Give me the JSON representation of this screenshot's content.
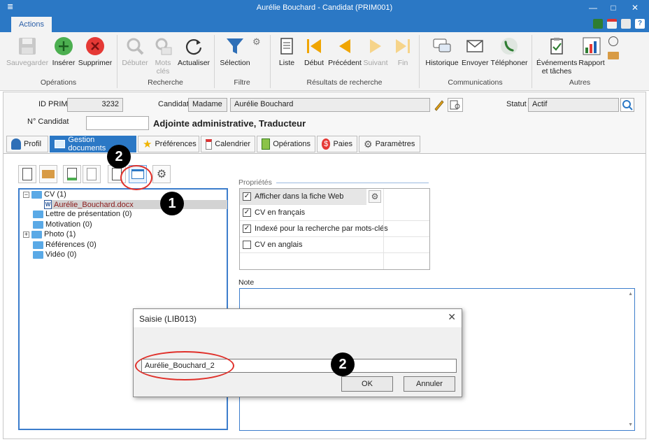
{
  "window": {
    "title": "Aurélie Bouchard - Candidat (PRIM001)",
    "sysmenu": "≣",
    "min": "—",
    "max": "□",
    "close": "✕"
  },
  "ribbon_tab": "Actions",
  "ribbon": {
    "save": "Sauvegarder",
    "insert": "Insérer",
    "delete": "Supprimer",
    "start": "Débuter",
    "keywords": "Mots clés",
    "refresh": "Actualiser",
    "selection": "Sélection",
    "list": "Liste",
    "first": "Début",
    "previous": "Précédent",
    "next": "Suivant",
    "last": "Fin",
    "history": "Historique",
    "send": "Envoyer",
    "phone": "Téléphoner",
    "events": "Événements et tâches",
    "report": "Rapport",
    "groups": {
      "operations": "Opérations",
      "search": "Recherche",
      "filter": "Filtre",
      "results": "Résultats de recherche",
      "communications": "Communications",
      "others": "Autres"
    }
  },
  "header": {
    "id_label": "ID PRIM",
    "id_value": "3232",
    "candidate_label": "Candidat",
    "title_value": "Madame",
    "name_value": "Aurélie Bouchard",
    "status_label": "Statut",
    "status_value": "Actif",
    "number_label": "N° Candidat",
    "number_value": "",
    "position": "Adjointe administrative, Traducteur"
  },
  "tabs": [
    "Profil",
    "Gestion documents",
    "Préférences",
    "Calendrier",
    "Opérations",
    "Paies",
    "Paramètres"
  ],
  "tree": {
    "cv": "CV (1)",
    "cv_file": "Aurélie_Bouchard.docx",
    "letter": "Lettre de présentation (0)",
    "motivation": "Motivation (0)",
    "photo": "Photo (1)",
    "references": "Références (0)",
    "video": "Vidéo (0)"
  },
  "properties": {
    "label": "Propriétés",
    "items": [
      {
        "label": "Afficher dans la fiche Web",
        "checked": true
      },
      {
        "label": "CV en français",
        "checked": true
      },
      {
        "label": "Indexé pour la recherche par mots-clés",
        "checked": true
      },
      {
        "label": "CV en anglais",
        "checked": false
      }
    ]
  },
  "note_label": "Note",
  "dialog": {
    "title": "Saisie (LIB013)",
    "value": "Aurélie_Bouchard_2",
    "ok": "OK",
    "cancel": "Annuler"
  },
  "markers": {
    "one": "1",
    "two": "2"
  },
  "colors": {
    "accent": "#2b78c5",
    "annotation": "#e0302a"
  }
}
